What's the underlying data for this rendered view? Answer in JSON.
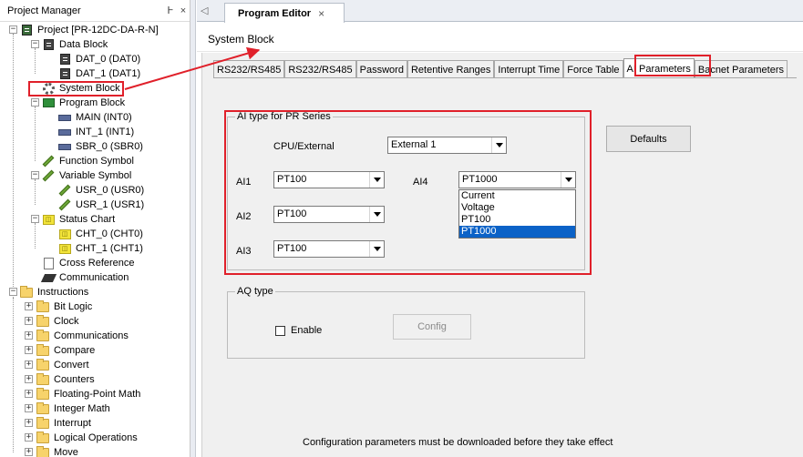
{
  "project_manager": {
    "title": "Project Manager",
    "pin_glyph": "Ͱ",
    "close_glyph": "×",
    "tree": [
      {
        "label": "Project [PR-12DC-DA-R-N]",
        "icon": "project-icon"
      },
      {
        "label": "Data Block",
        "icon": "data-block-icon"
      },
      {
        "label": "DAT_0 (DAT0)",
        "icon": "data-table-icon"
      },
      {
        "label": "DAT_1 (DAT1)",
        "icon": "data-table-icon"
      },
      {
        "label": "System Block",
        "icon": "gear-icon"
      },
      {
        "label": "Program Block",
        "icon": "program-block-icon"
      },
      {
        "label": "MAIN (INT0)",
        "icon": "pou-icon"
      },
      {
        "label": "INT_1 (INT1)",
        "icon": "pou-icon"
      },
      {
        "label": "SBR_0 (SBR0)",
        "icon": "pou-icon"
      },
      {
        "label": "Function Symbol",
        "icon": "pencil-icon"
      },
      {
        "label": "Variable Symbol",
        "icon": "pencil-icon"
      },
      {
        "label": "USR_0 (USR0)",
        "icon": "pencil-icon"
      },
      {
        "label": "USR_1 (USR1)",
        "icon": "pencil-icon"
      },
      {
        "label": "Status Chart",
        "icon": "status-chart-icon"
      },
      {
        "label": "CHT_0 (CHT0)",
        "icon": "chart-icon"
      },
      {
        "label": "CHT_1 (CHT1)",
        "icon": "chart-icon"
      },
      {
        "label": "Cross Reference",
        "icon": "document-icon"
      },
      {
        "label": "Communication",
        "icon": "communication-icon"
      },
      {
        "label": "Instructions",
        "icon": "folder-icon"
      },
      {
        "label": "Bit Logic",
        "icon": "folder-icon"
      },
      {
        "label": "Clock",
        "icon": "folder-icon"
      },
      {
        "label": "Communications",
        "icon": "folder-icon"
      },
      {
        "label": "Compare",
        "icon": "folder-icon"
      },
      {
        "label": "Convert",
        "icon": "folder-icon"
      },
      {
        "label": "Counters",
        "icon": "folder-icon"
      },
      {
        "label": "Floating-Point Math",
        "icon": "folder-icon"
      },
      {
        "label": "Integer Math",
        "icon": "folder-icon"
      },
      {
        "label": "Interrupt",
        "icon": "folder-icon"
      },
      {
        "label": "Logical Operations",
        "icon": "folder-icon"
      },
      {
        "label": "Move",
        "icon": "folder-icon"
      }
    ]
  },
  "editor": {
    "tab_label": "Program Editor",
    "tab_close": "×",
    "scroll_left_glyph": "◁",
    "title": "System Block",
    "tabs": [
      {
        "label": "RS232/RS485"
      },
      {
        "label": "RS232/RS485"
      },
      {
        "label": "Password"
      },
      {
        "label": "Retentive Ranges"
      },
      {
        "label": "Interrupt Time"
      },
      {
        "label": "Force Table"
      },
      {
        "label": "AI Parameters"
      },
      {
        "label": "Bacnet Parameters"
      }
    ],
    "active_tab": "AI Parameters",
    "ai_group": {
      "label": "AI type for PR Series",
      "cpu_external_label": "CPU/External",
      "cpu_external_value": "External 1",
      "ai1_label": "AI1",
      "ai1_value": "PT100",
      "ai2_label": "AI2",
      "ai2_value": "PT100",
      "ai3_label": "AI3",
      "ai3_value": "PT100",
      "ai4_label": "AI4",
      "ai4_value": "PT1000",
      "ai4_options": [
        "Current",
        "Voltage",
        "PT100",
        "PT1000"
      ],
      "ai4_highlighted": "PT1000"
    },
    "defaults_button": "Defaults",
    "aq_group": {
      "label": "AQ type",
      "enable_label": "Enable",
      "enable_checked": false,
      "config_button": "Config"
    },
    "footer_note": "Configuration parameters must be downloaded before they take effect"
  },
  "annotation_color": "#e0202a",
  "selection_color": "#0b62c7"
}
